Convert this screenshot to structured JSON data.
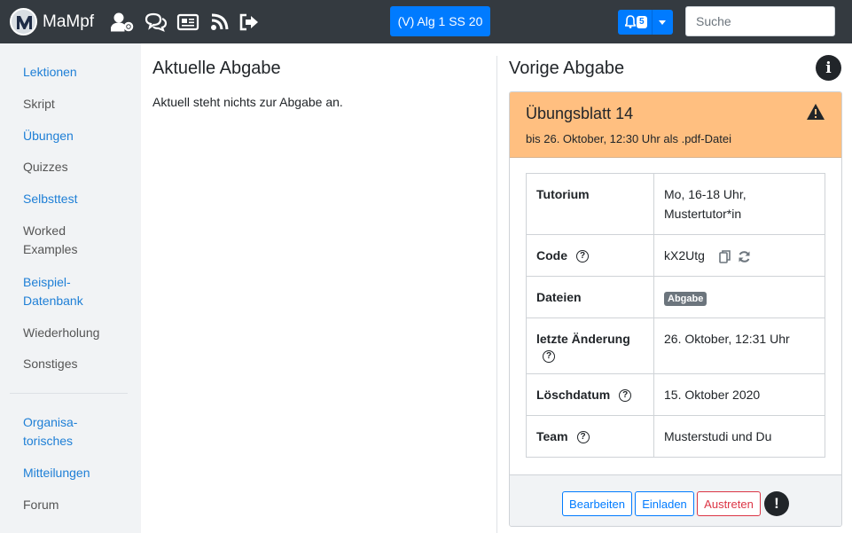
{
  "navbar": {
    "brand": "MaMpf",
    "icons": [
      "user-cog-icon",
      "comments-icon",
      "newspaper-icon",
      "blog-icon",
      "sign-out-icon"
    ],
    "lecture_button": "(V) Alg 1 SS 20",
    "notification_count": "5",
    "search_placeholder": "Suche"
  },
  "sidebar": {
    "items": [
      {
        "label": "Lektionen",
        "active": true
      },
      {
        "label": "Skript",
        "active": false
      },
      {
        "label": "Übungen",
        "active": true
      },
      {
        "label": "Quizzes",
        "active": false
      },
      {
        "label": "Selbsttest",
        "active": true
      },
      {
        "label": "Worked Examples",
        "active": false
      },
      {
        "label": "Beispiel-Datenbank",
        "active": true
      },
      {
        "label": "Wiederholung",
        "active": false
      },
      {
        "label": "Sonstiges",
        "active": false
      },
      {
        "label": "Organisa-torisches",
        "active": true
      },
      {
        "label": "Mitteilungen",
        "active": true
      },
      {
        "label": "Forum",
        "active": false
      }
    ]
  },
  "current": {
    "heading": "Aktuelle Abgabe",
    "text": "Aktuell steht nichts zur Abgabe an."
  },
  "previous": {
    "heading": "Vorige Abgabe",
    "sheet_title": "Übungsblatt 14",
    "deadline": "bis 26. Oktober, 12:30 Uhr als .pdf-Datei",
    "rows": {
      "tutorium_label": "Tutorium",
      "tutorium_value": "Mo, 16-18 Uhr, Mustertutor*in",
      "code_label": "Code",
      "code_value": "kX2Utg",
      "files_label": "Dateien",
      "files_badge": "Abgabe",
      "changed_label": "letzte Änderung",
      "changed_value": "26. Oktober, 12:31 Uhr",
      "deletion_label": "Löschdatum",
      "deletion_value": "15. Oktober 2020",
      "team_label": "Team",
      "team_value": "Musterstudi und Du"
    },
    "buttons": {
      "edit": "Bearbeiten",
      "invite": "Einladen",
      "leave": "Austreten"
    }
  },
  "colors": {
    "navbar": "#343a40",
    "primary": "#007bff",
    "card_header": "#ffbf80",
    "danger": "#dc3545"
  }
}
